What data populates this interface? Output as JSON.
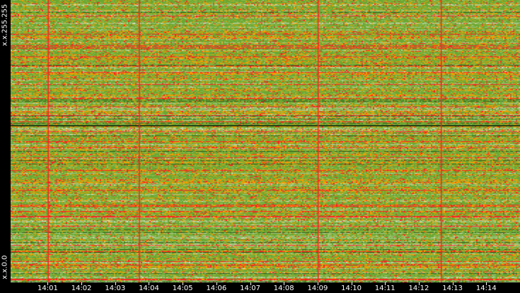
{
  "chart_data": {
    "type": "heatmap",
    "title": "",
    "xlabel": "",
    "ylabel": "",
    "x_ticks": [
      "14:01",
      "14:02",
      "14:03",
      "14:04",
      "14:05",
      "14:06",
      "14:07",
      "14:08",
      "14:09",
      "14:10",
      "14:11",
      "14:12",
      "14:13",
      "14:14"
    ],
    "x_tick_minutes": [
      1,
      2,
      3,
      4,
      5,
      6,
      7,
      8,
      9,
      10,
      11,
      12,
      13,
      14
    ],
    "xlim_minutes_after_14_00": [
      -0.1,
      15.0
    ],
    "y_labels": {
      "top": "x.x.255.255",
      "bottom": "x.x.0.0"
    },
    "vertical_event_lines_minutes": [
      1.0,
      3.7,
      9.0,
      12.65
    ],
    "color_scale": {
      "low": "#6aa832",
      "low_light": "#a6c98a",
      "mid": "#f0a000",
      "high": "#ff2020",
      "dark": "#2e5e1c"
    },
    "grid": false
  }
}
